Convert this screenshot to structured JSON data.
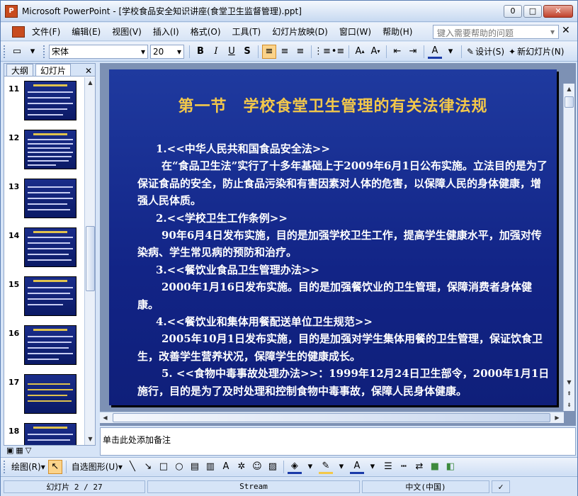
{
  "window": {
    "title": "Microsoft PowerPoint - [学校食品安全知识讲座(食堂卫生监督管理).ppt]",
    "min": "0",
    "max": "□",
    "close": "✕"
  },
  "menu": {
    "items": [
      "文件(F)",
      "编辑(E)",
      "视图(V)",
      "插入(I)",
      "格式(O)",
      "工具(T)",
      "幻灯片放映(D)",
      "窗口(W)",
      "帮助(H)"
    ],
    "help_placeholder": "键入需要帮助的问题"
  },
  "toolbar": {
    "font": "宋体",
    "size": "20",
    "design_label": "设计(S)",
    "new_slide_label": "新幻灯片(N)"
  },
  "left_pane": {
    "tabs": [
      "大纲",
      "幻灯片"
    ],
    "close": "✕",
    "thumbnails": [
      "11",
      "12",
      "13",
      "14",
      "15",
      "16",
      "17",
      "18"
    ]
  },
  "slide": {
    "title": "第一节　学校食堂卫生管理的有关法律法规",
    "paragraphs": [
      {
        "kind": "h",
        "text": "1.<<中华人民共和国食品安全法>>"
      },
      {
        "kind": "p",
        "text": "在“食品卫生法”实行了十多年基础上于2009年6月1日公布实施。立法目的是为了保证食品的安全，防止食品污染和有害因素对人体的危害，以保障人民的身体健康，增强人民体质。"
      },
      {
        "kind": "h",
        "text": "2.<<学校卫生工作条例>>"
      },
      {
        "kind": "p",
        "text": "90年6月4日发布实施，目的是加强学校卫生工作，提高学生健康水平，加强对传染病、学生常见病的预防和治疗。"
      },
      {
        "kind": "h",
        "text": "3.<<餐饮业食品卫生管理办法>>"
      },
      {
        "kind": "p",
        "text": "2000年1月16日发布实施。目的是加强餐饮业的卫生管理，保障消费者身体健康。"
      },
      {
        "kind": "h",
        "text": "4.<<餐饮业和集体用餐配送单位卫生规范>>"
      },
      {
        "kind": "p",
        "text": "2005年10月1日发布实施，目的是加强对学生集体用餐的卫生管理，保证饮食卫生，改善学生营养状况，保障学生的健康成长。"
      },
      {
        "kind": "p",
        "text": "5. <<食物中毒事故处理办法>>：1999年12月24日卫生部令，2000年1月1日施行，目的是为了及时处理和控制食物中毒事故，保障人民身体健康。"
      }
    ]
  },
  "notes": {
    "placeholder": "单击此处添加备注"
  },
  "drawbar": {
    "draw_label": "绘图(R)",
    "autoshape_label": "自选图形(U)"
  },
  "status": {
    "slide": "幻灯片 2 / 27",
    "design": "Stream",
    "language": "中文(中国)"
  }
}
